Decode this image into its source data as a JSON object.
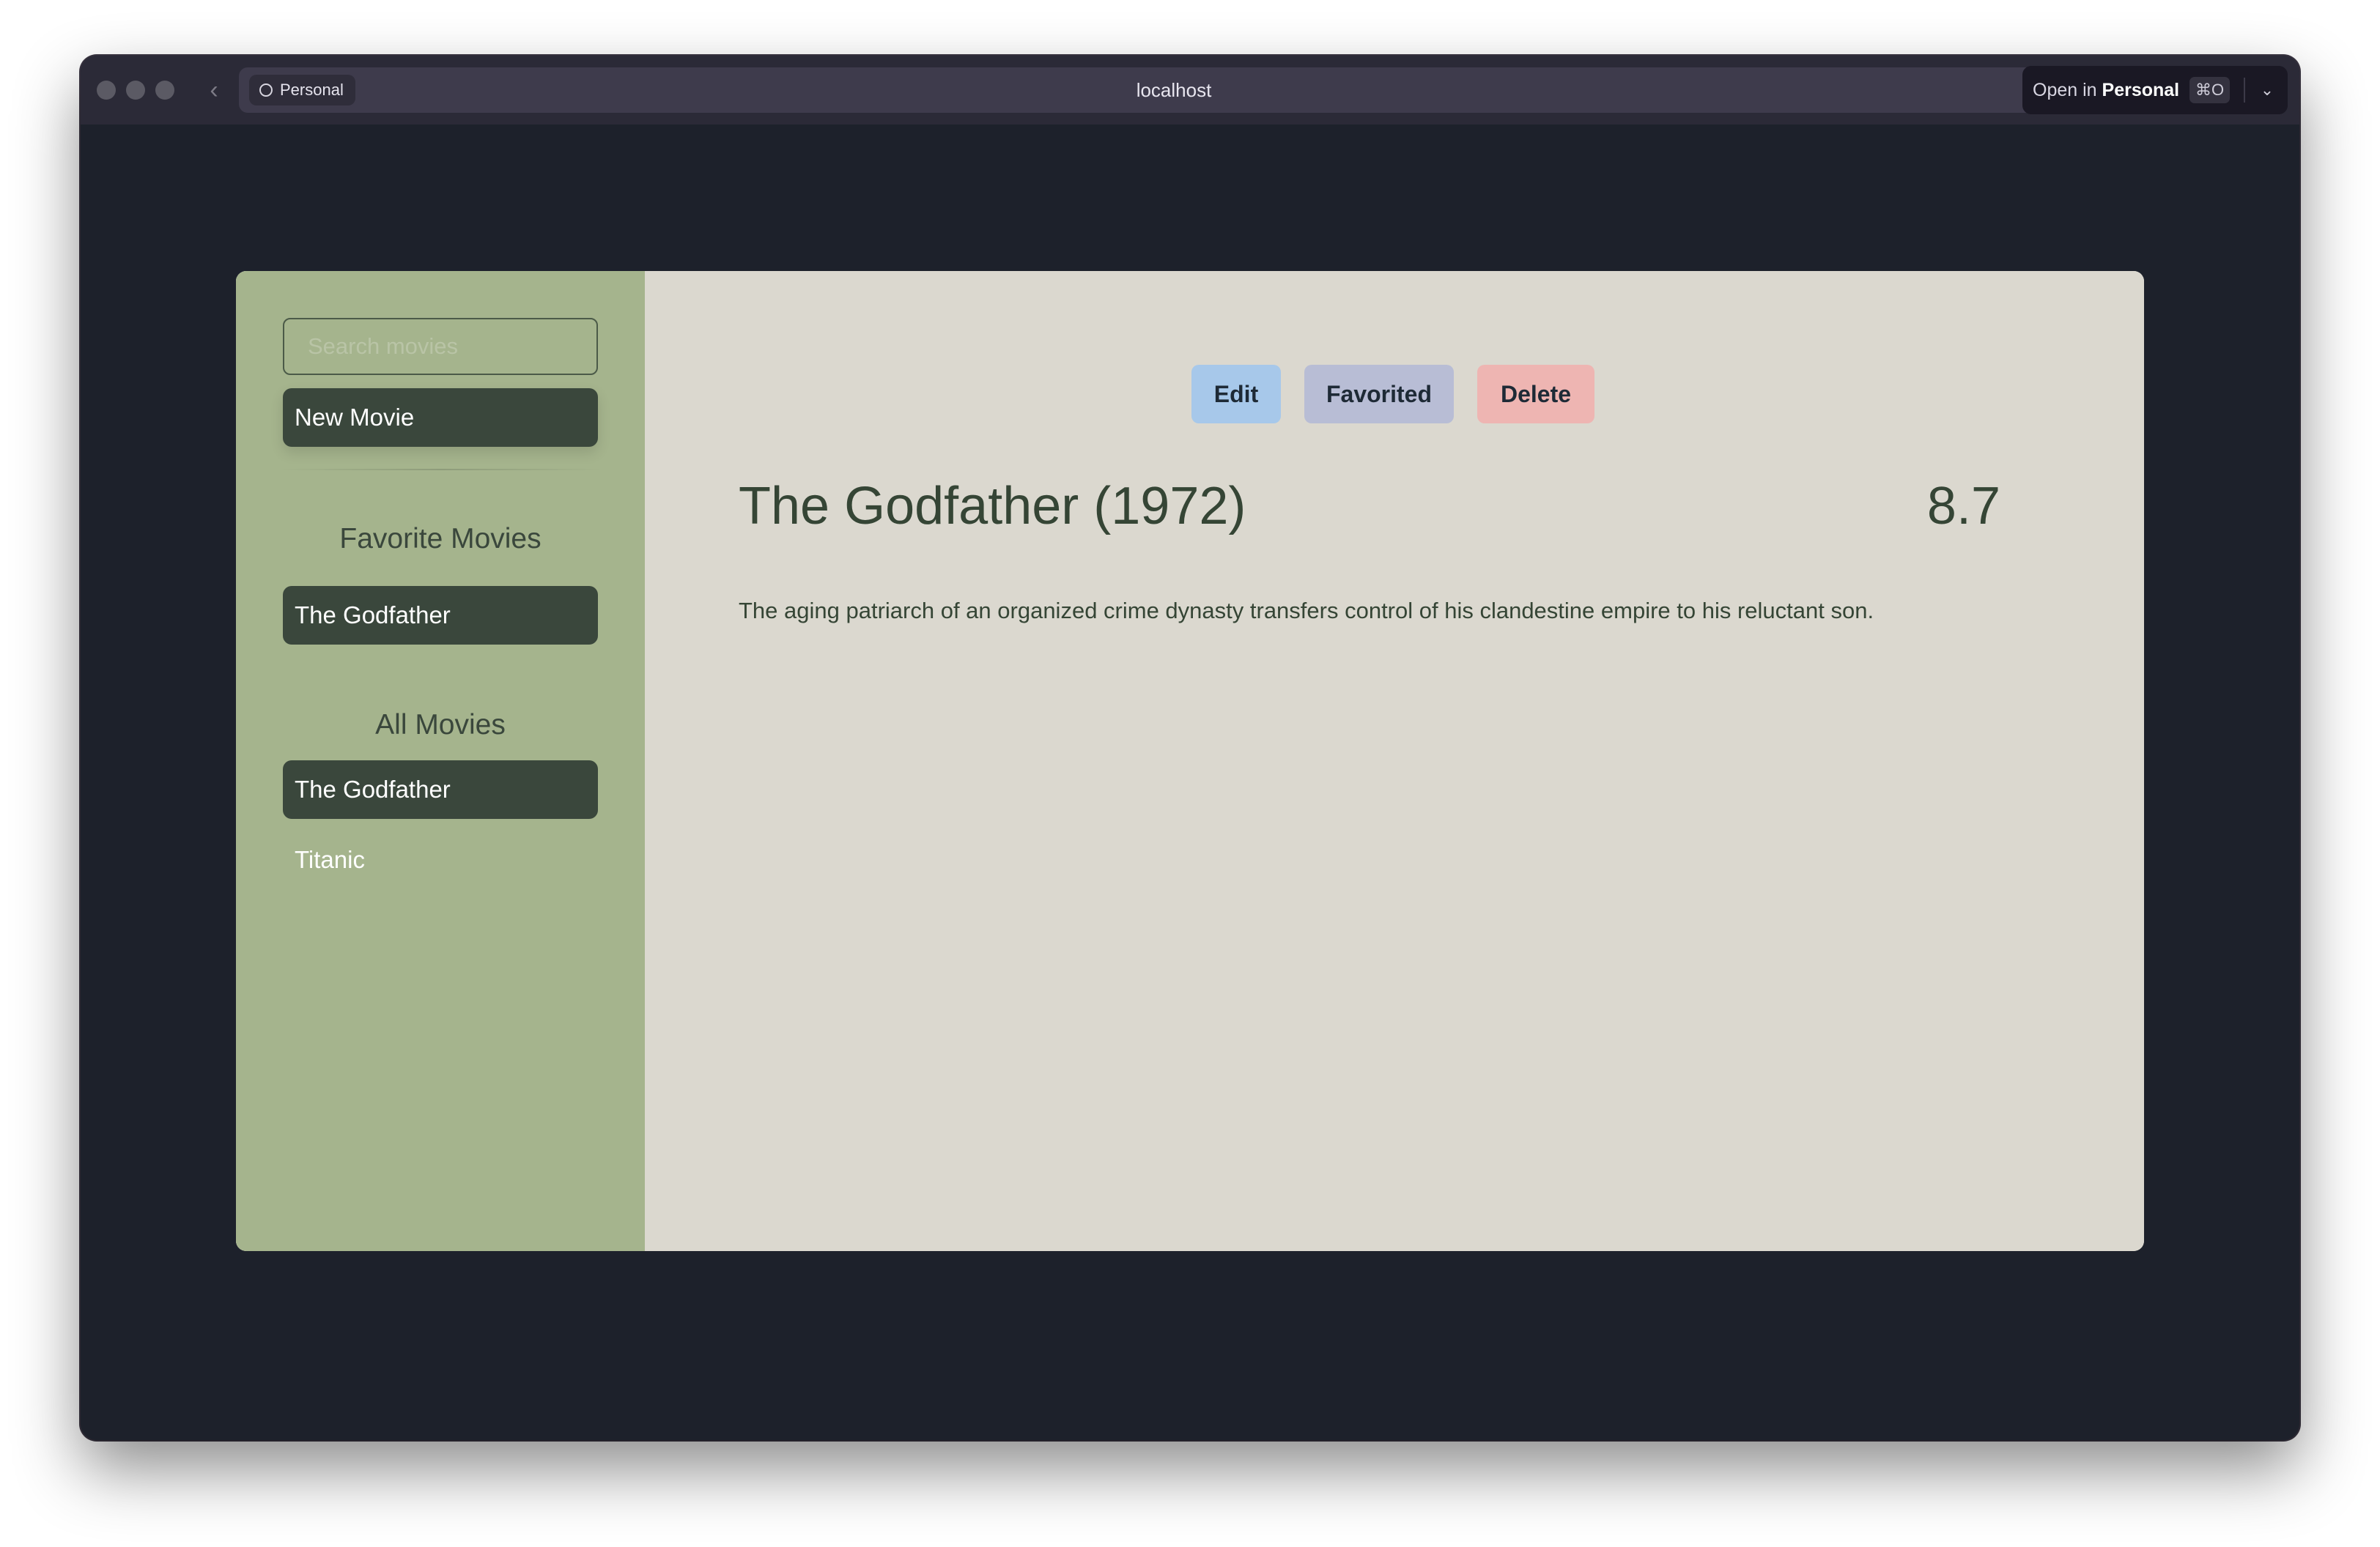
{
  "browser": {
    "url": "localhost",
    "profile_label": "Personal",
    "open_in_prefix": "Open in",
    "open_in_profile": "Personal",
    "open_in_shortcut": "⌘O"
  },
  "sidebar": {
    "search_placeholder": "Search movies",
    "new_movie_label": "New Movie",
    "favorites_title": "Favorite Movies",
    "favorites": [
      "The Godfather"
    ],
    "all_title": "All Movies",
    "all_movies": [
      "The Godfather",
      "Titanic"
    ]
  },
  "movie": {
    "edit_label": "Edit",
    "favorited_label": "Favorited",
    "delete_label": "Delete",
    "title": "The Godfather (1972)",
    "rating": "8.7",
    "description": "The aging patriarch of an organized crime dynasty transfers control of his clandestine empire to his reluctant son."
  },
  "colors": {
    "sidebar_bg": "#a5b48d",
    "main_bg": "#dbd8cf",
    "accent_dark": "#3a473c",
    "edit_btn": "#a7c8ea",
    "favorited_btn": "#b8bdd5",
    "delete_btn": "#eeb5b2"
  }
}
